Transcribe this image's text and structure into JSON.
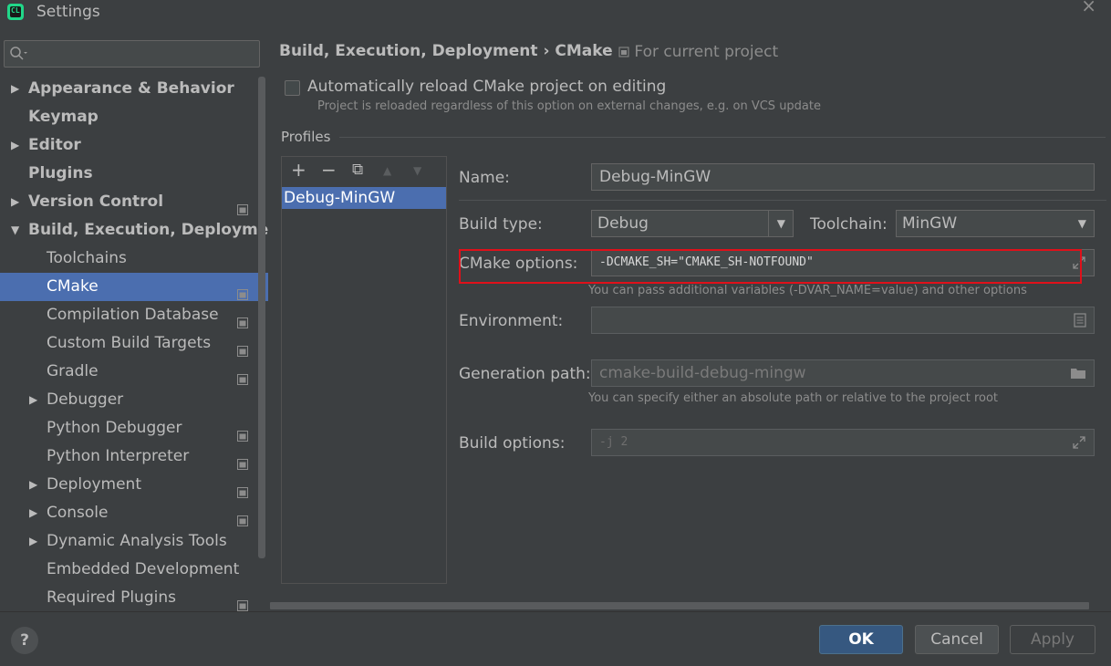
{
  "window": {
    "title": "Settings",
    "close_icon": "close-icon"
  },
  "search": {
    "placeholder": ""
  },
  "tree": [
    {
      "label": "Appearance & Behavior",
      "bold": true,
      "arrow": "right",
      "indent": 0,
      "project_icon": false
    },
    {
      "label": "Keymap",
      "bold": true,
      "arrow": "none",
      "indent": 0,
      "project_icon": false
    },
    {
      "label": "Editor",
      "bold": true,
      "arrow": "right",
      "indent": 0,
      "project_icon": false
    },
    {
      "label": "Plugins",
      "bold": true,
      "arrow": "none",
      "indent": 0,
      "project_icon": false
    },
    {
      "label": "Version Control",
      "bold": true,
      "arrow": "right",
      "indent": 0,
      "project_icon": true
    },
    {
      "label": "Build, Execution, Deployment",
      "bold": true,
      "arrow": "down",
      "indent": 0,
      "project_icon": false
    },
    {
      "label": "Toolchains",
      "bold": false,
      "arrow": "none",
      "indent": 1,
      "project_icon": false
    },
    {
      "label": "CMake",
      "bold": false,
      "arrow": "none",
      "indent": 1,
      "project_icon": true,
      "selected": true
    },
    {
      "label": "Compilation Database",
      "bold": false,
      "arrow": "none",
      "indent": 1,
      "project_icon": true
    },
    {
      "label": "Custom Build Targets",
      "bold": false,
      "arrow": "none",
      "indent": 1,
      "project_icon": true
    },
    {
      "label": "Gradle",
      "bold": false,
      "arrow": "none",
      "indent": 1,
      "project_icon": true
    },
    {
      "label": "Debugger",
      "bold": false,
      "arrow": "right",
      "indent": 1,
      "project_icon": false
    },
    {
      "label": "Python Debugger",
      "bold": false,
      "arrow": "none",
      "indent": 1,
      "project_icon": true
    },
    {
      "label": "Python Interpreter",
      "bold": false,
      "arrow": "none",
      "indent": 1,
      "project_icon": true
    },
    {
      "label": "Deployment",
      "bold": false,
      "arrow": "right",
      "indent": 1,
      "project_icon": true
    },
    {
      "label": "Console",
      "bold": false,
      "arrow": "right",
      "indent": 1,
      "project_icon": true
    },
    {
      "label": "Dynamic Analysis Tools",
      "bold": false,
      "arrow": "right",
      "indent": 1,
      "project_icon": false
    },
    {
      "label": "Embedded Development",
      "bold": false,
      "arrow": "none",
      "indent": 1,
      "project_icon": false
    },
    {
      "label": "Required Plugins",
      "bold": false,
      "arrow": "none",
      "indent": 1,
      "project_icon": true
    }
  ],
  "header": {
    "breadcrumb": "Build, Execution, Deployment  ›  CMake",
    "for_project": "For current project"
  },
  "auto_reload": {
    "label": "Automatically reload CMake project on editing",
    "hint": "Project is reloaded regardless of this option on external changes, e.g. on VCS update",
    "checked": false
  },
  "profiles": {
    "label": "Profiles",
    "toolbar": {
      "add": "+",
      "remove": "−",
      "copy": "⧉",
      "up": "▲",
      "down": "▼"
    },
    "items": [
      "Debug-MinGW"
    ]
  },
  "form": {
    "name_label": "Name:",
    "name_value": "Debug-MinGW",
    "build_type_label": "Build type:",
    "build_type_value": "Debug",
    "toolchain_label": "Toolchain:",
    "toolchain_value": "MinGW",
    "cmake_options_label": "CMake options:",
    "cmake_options_value": "-DCMAKE_SH=\"CMAKE_SH-NOTFOUND\"",
    "cmake_options_hint": "You can pass additional variables (-DVAR_NAME=value) and other options",
    "environment_label": "Environment:",
    "environment_value": "",
    "generation_path_label": "Generation path:",
    "generation_path_value": "cmake-build-debug-mingw",
    "generation_path_hint": "You can specify either an absolute path or relative to the project root",
    "build_options_label": "Build options:",
    "build_options_value": "-j 2"
  },
  "buttons": {
    "help": "?",
    "ok": "OK",
    "cancel": "Cancel",
    "apply": "Apply"
  },
  "colors": {
    "background": "#3c3f41",
    "selection": "#4b6eaf",
    "highlight_border": "#e0101a",
    "ok_button": "#365880"
  }
}
